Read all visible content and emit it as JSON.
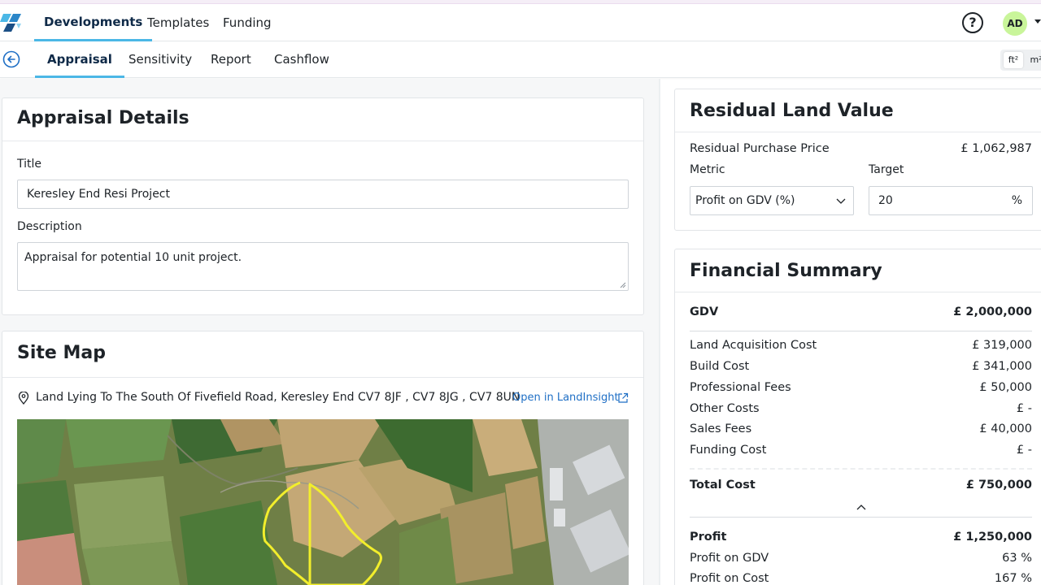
{
  "top_nav": {
    "tabs": [
      {
        "label": "Developments",
        "active": true
      },
      {
        "label": "Templates",
        "active": false
      },
      {
        "label": "Funding",
        "active": false
      }
    ],
    "help_icon": "question-circle-icon",
    "avatar_initials": "AD",
    "avatar_color": "#c9f59a",
    "accent_color": "#4bb7e6"
  },
  "sub_nav": {
    "tabs": [
      {
        "label": "Appraisal",
        "active": true
      },
      {
        "label": "Sensitivity",
        "active": false
      },
      {
        "label": "Report",
        "active": false
      },
      {
        "label": "Cashflow",
        "active": false
      }
    ],
    "units": [
      "ft²",
      "m²"
    ],
    "selected_unit": "ft²"
  },
  "appraisal_details": {
    "title": "Appraisal Details",
    "title_label": "Title",
    "title_value": "Keresley End Resi Project",
    "description_label": "Description",
    "description_value": "Appraisal for potential 10 unit project."
  },
  "site_map": {
    "title": "Site Map",
    "address": "Land Lying To The South Of Fivefield Road, Keresley End CV7 8JF , CV7 8JG , CV7 8UN",
    "open_link": "Open in LandInsight"
  },
  "residual_land_value": {
    "title": "Residual Land Value",
    "purchase_price_label": "Residual Purchase Price",
    "purchase_price_value": "£ 1,062,987",
    "metric_label": "Metric",
    "metric_value": "Profit on GDV (%)",
    "target_label": "Target",
    "target_value": "20",
    "target_unit": "%"
  },
  "financial_summary": {
    "title": "Financial Summary",
    "gdv": {
      "label": "GDV",
      "value": "£ 2,000,000"
    },
    "costs": [
      {
        "label": "Land Acquisition Cost",
        "value": "£ 319,000"
      },
      {
        "label": "Build Cost",
        "value": "£ 341,000"
      },
      {
        "label": "Professional Fees",
        "value": "£ 50,000"
      },
      {
        "label": "Other Costs",
        "value": "£ -"
      },
      {
        "label": "Sales Fees",
        "value": "£ 40,000"
      },
      {
        "label": "Funding Cost",
        "value": "£ -"
      }
    ],
    "total_cost": {
      "label": "Total Cost",
      "value": "£ 750,000"
    },
    "profit": {
      "label": "Profit",
      "value": "£ 1,250,000"
    },
    "profit_on_gdv": {
      "label": "Profit on GDV",
      "value": "63 %"
    },
    "profit_on_cost": {
      "label": "Profit on Cost",
      "value": "167 %"
    }
  }
}
